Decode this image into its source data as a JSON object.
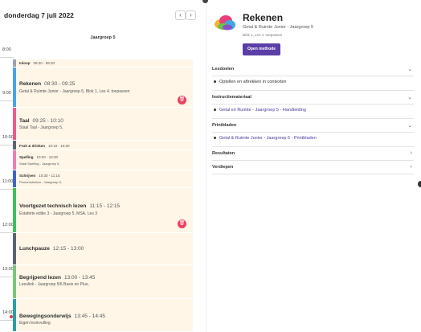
{
  "header": {
    "date": "donderdag 7 juli 2022",
    "prev_icon": "chevron-left-icon",
    "next_icon": "chevron-right-icon",
    "prev_glyph": "‹",
    "next_glyph": "›",
    "column_title": "Jaargroep 5"
  },
  "hours": [
    "8:00",
    "9:00",
    "10:00",
    "11:00",
    "12:00",
    "13:00",
    "14:00"
  ],
  "events": [
    {
      "title": "Inloop",
      "time": "08:20 - 08:30",
      "subtitle": "",
      "color": "#9aa3ad"
    },
    {
      "title": "Rekenen",
      "time": "08:30 - 09:25",
      "subtitle": "Getal & Ruimte Junior - Jaargroep 5, Blok 1, Les 4. toepassen",
      "color": "#4aa3e8"
    },
    {
      "title": "Taal",
      "time": "09:25 - 10:10",
      "subtitle": "Staal Taal - Jaargroep 5,",
      "color": "#ef5a8a"
    },
    {
      "title": "Fruit & drinken",
      "time": "10:10 - 10:20",
      "subtitle": "",
      "color": "#5c6370"
    },
    {
      "title": "Spelling",
      "time": "10:20 - 10:30",
      "subtitle": "Staal Spelling - Jaargroep 5,",
      "color": "#e97fb0"
    },
    {
      "title": "Schrijven",
      "time": "10:30 - 11:15",
      "subtitle": "Pennenstreken - Jaargroep 5,",
      "color": "#3f63c7"
    },
    {
      "title": "Voortgezet technisch lezen",
      "time": "11:15 - 12:15",
      "subtitle": "Estafette editie 3 - Jaargroep 5, MSA, Les 3",
      "color": "#3fbf5a"
    },
    {
      "title": "Lunchpauze",
      "time": "12:15 - 13:00",
      "subtitle": "",
      "color": "#5c6370"
    },
    {
      "title": "Begrijpend lezen",
      "time": "13:00 - 13:45",
      "subtitle": "Leeslink - Jaargroep 5/6 Basis en Plus,",
      "color": "#7ac77a"
    },
    {
      "title": "Bewegingsonderwijs",
      "time": "13:45 - 14:45",
      "subtitle": "Eigen lesinvulling",
      "color": "#2a9fa8"
    }
  ],
  "trash_icon": "trash-icon",
  "trash_glyph": "🗑",
  "detail": {
    "title": "Rekenen",
    "subtitle": "Getal & Ruimte Junior - Jaargroep 5",
    "meta": "Blok 1, Les 4. toepassen",
    "logo_icon": "cloud-logo-icon",
    "open_button": "Open methode",
    "sections": [
      {
        "label": "Lesdoelen",
        "icon": "chevron-down-icon",
        "glyph": "⌄",
        "items": [
          "Optellen en aftrekken in contexten"
        ],
        "links": false
      },
      {
        "label": "Instructiemateriaal",
        "icon": "chevron-down-icon",
        "glyph": "⌄",
        "items": [
          "Getal en Ruimte - Jaargroep 5 - Handleiding"
        ],
        "links": true
      },
      {
        "label": "Printbladen",
        "icon": "chevron-down-icon",
        "glyph": "⌄",
        "items": [
          "Getal & Ruimte Junior - Jaargroep 5 - Printbladen"
        ],
        "links": true
      },
      {
        "label": "Resultaten",
        "icon": "chevron-right-icon",
        "glyph": "›",
        "items": [],
        "links": false
      },
      {
        "label": "Verdiepen",
        "icon": "chevron-right-icon",
        "glyph": "›",
        "items": [],
        "links": false
      }
    ]
  }
}
